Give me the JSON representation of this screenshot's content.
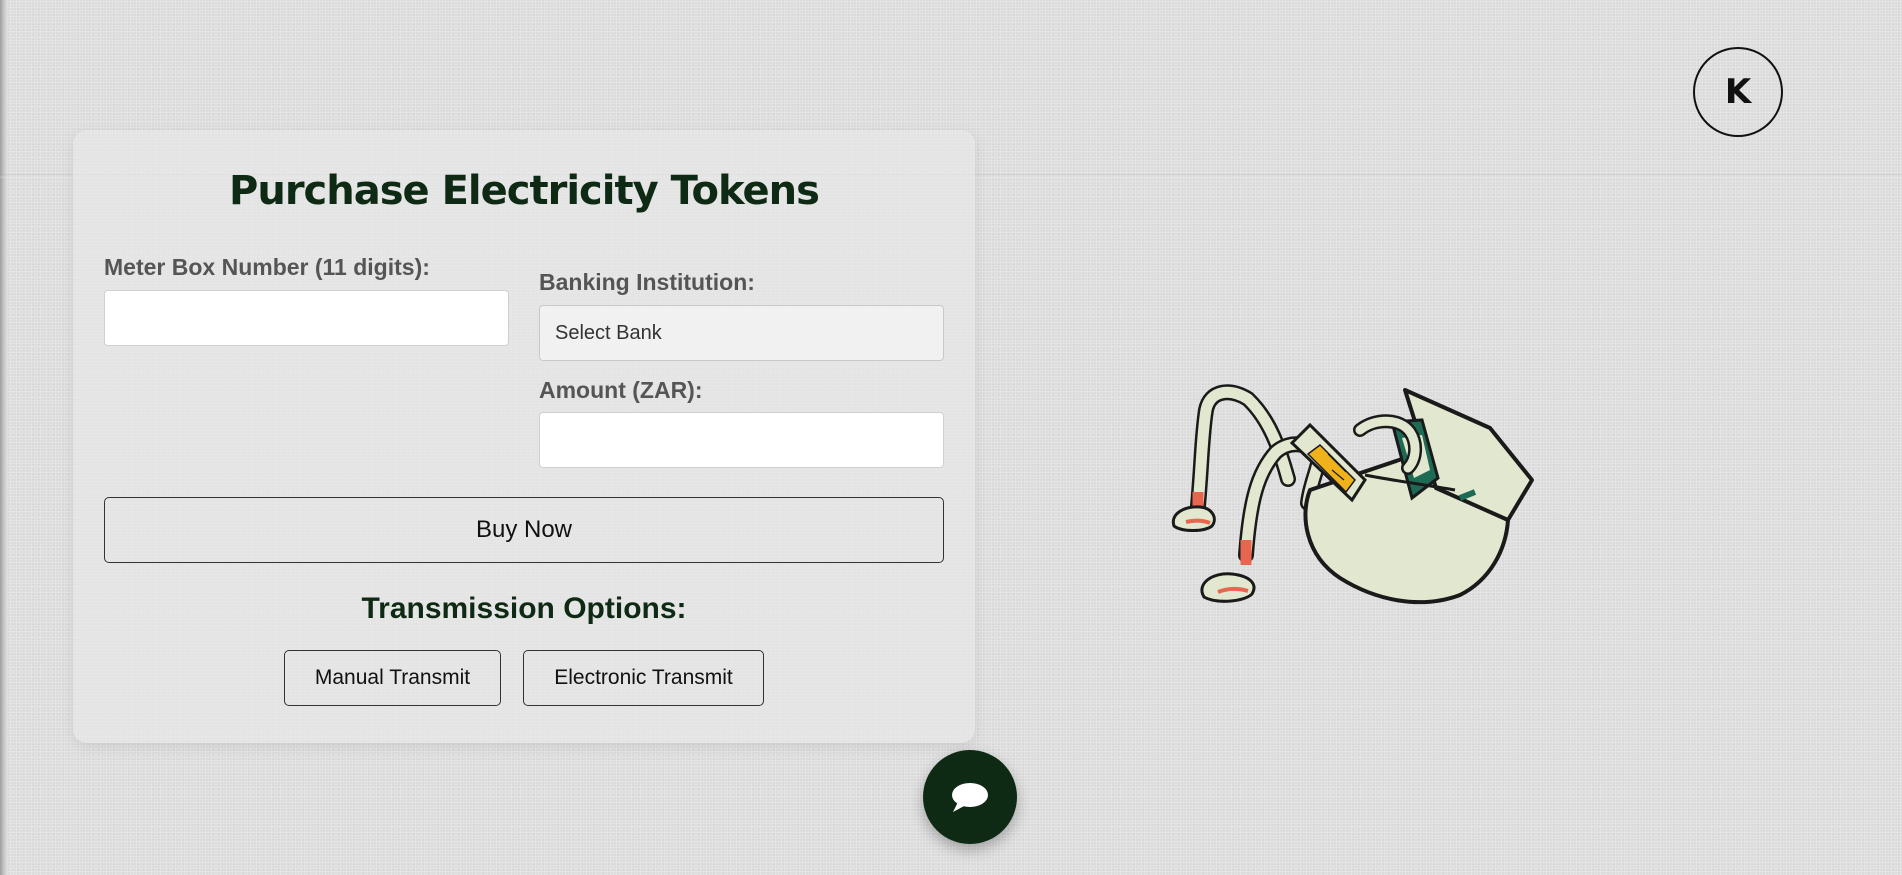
{
  "header": {
    "logo_letter": "K"
  },
  "form": {
    "title": "Purchase Electricity Tokens",
    "meter": {
      "label": "Meter Box Number (11 digits):",
      "value": "",
      "placeholder": ""
    },
    "bank": {
      "label": "Banking Institution:",
      "selected": "Select Bank"
    },
    "amount": {
      "label": "Amount (ZAR):",
      "value": "",
      "placeholder": ""
    },
    "buy_label": "Buy Now"
  },
  "transmission": {
    "title": "Transmission Options:",
    "options": [
      {
        "label": "Manual Transmit"
      },
      {
        "label": "Electronic Transmit"
      }
    ]
  },
  "chat": {
    "icon": "chat-bubble-icon"
  },
  "mascot": {
    "description_icon": "electricity-meter-mascot-icon"
  },
  "colors": {
    "brand_dark": "#0f2a14",
    "page_bg": "#dcdcdc",
    "card_bg": "#e8e8e8",
    "mascot_fill": "#e2e8cf",
    "mascot_accent_red": "#e8654f",
    "mascot_accent_teal": "#1e6b55",
    "mascot_accent_yellow": "#f0b21b"
  }
}
